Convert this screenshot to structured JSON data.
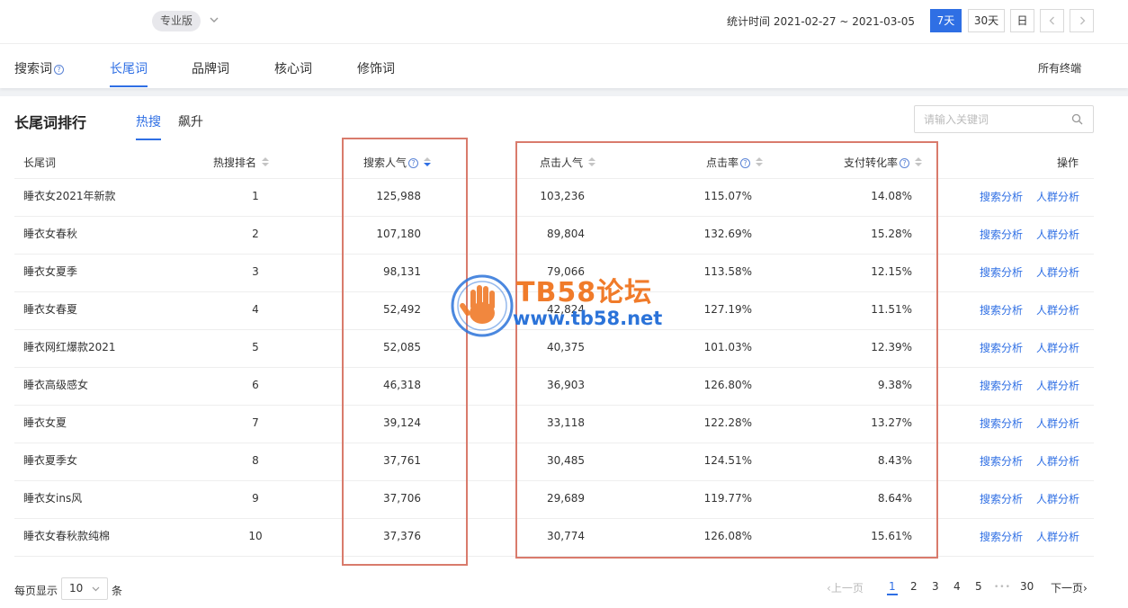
{
  "header": {
    "edition_label": "专业版",
    "date_range": "统计时间 2021-02-27 ~ 2021-03-05",
    "periods": [
      "7天",
      "30天",
      "日"
    ],
    "active_period": "7天"
  },
  "main_tabs": [
    {
      "label": "搜索词",
      "help": "?"
    },
    {
      "label": "长尾词"
    },
    {
      "label": "品牌词"
    },
    {
      "label": "核心词"
    },
    {
      "label": "修饰词"
    }
  ],
  "active_main_tab": "长尾词",
  "terminal_select": {
    "value": "所有终端"
  },
  "ranking": {
    "title": "长尾词排行",
    "sub_tabs": [
      "热搜",
      "飙升"
    ],
    "active_sub_tab": "热搜",
    "search_placeholder": "请输入关键词"
  },
  "table": {
    "columns": [
      "长尾词",
      "热搜排名",
      "搜索人气",
      "点击人气",
      "点击率",
      "支付转化率",
      "操作"
    ],
    "actions": [
      "搜索分析",
      "人群分析"
    ],
    "rows": [
      {
        "keyword": "睡衣女2021年新款",
        "rank": "1",
        "search_pop": "125,988",
        "click_pop": "103,236",
        "ctr": "115.07%",
        "cvr": "14.08%"
      },
      {
        "keyword": "睡衣女春秋",
        "rank": "2",
        "search_pop": "107,180",
        "click_pop": "89,804",
        "ctr": "132.69%",
        "cvr": "15.28%"
      },
      {
        "keyword": "睡衣女夏季",
        "rank": "3",
        "search_pop": "98,131",
        "click_pop": "79,066",
        "ctr": "113.58%",
        "cvr": "12.15%"
      },
      {
        "keyword": "睡衣女春夏",
        "rank": "4",
        "search_pop": "52,492",
        "click_pop": "42,824",
        "ctr": "127.19%",
        "cvr": "11.51%"
      },
      {
        "keyword": "睡衣网红爆款2021",
        "rank": "5",
        "search_pop": "52,085",
        "click_pop": "40,375",
        "ctr": "101.03%",
        "cvr": "12.39%"
      },
      {
        "keyword": "睡衣高级感女",
        "rank": "6",
        "search_pop": "46,318",
        "click_pop": "36,903",
        "ctr": "126.80%",
        "cvr": "9.38%"
      },
      {
        "keyword": "睡衣女夏",
        "rank": "7",
        "search_pop": "39,124",
        "click_pop": "33,118",
        "ctr": "122.28%",
        "cvr": "13.27%"
      },
      {
        "keyword": "睡衣夏季女",
        "rank": "8",
        "search_pop": "37,761",
        "click_pop": "30,485",
        "ctr": "124.51%",
        "cvr": "8.43%"
      },
      {
        "keyword": "睡衣女ins风",
        "rank": "9",
        "search_pop": "37,706",
        "click_pop": "29,689",
        "ctr": "119.77%",
        "cvr": "8.64%"
      },
      {
        "keyword": "睡衣女春秋款纯棉",
        "rank": "10",
        "search_pop": "37,376",
        "click_pop": "30,774",
        "ctr": "126.08%",
        "cvr": "15.61%"
      }
    ]
  },
  "watermark": {
    "title": "TB58论坛",
    "url": "www.tb58.net"
  },
  "footer": {
    "per_page_label": "每页显示",
    "per_page_value": "10",
    "per_page_unit": "条",
    "prev": "上一页",
    "pages": [
      "1",
      "2",
      "3",
      "4",
      "5"
    ],
    "ellipsis": "•••",
    "last_page": "30",
    "next": "下一页",
    "current_page": "1"
  },
  "colors": {
    "accent": "#2f6fe4",
    "highlight_box": "#d97b6c",
    "watermark_orange": "#f07b2a",
    "watermark_blue": "#2b73d9"
  }
}
